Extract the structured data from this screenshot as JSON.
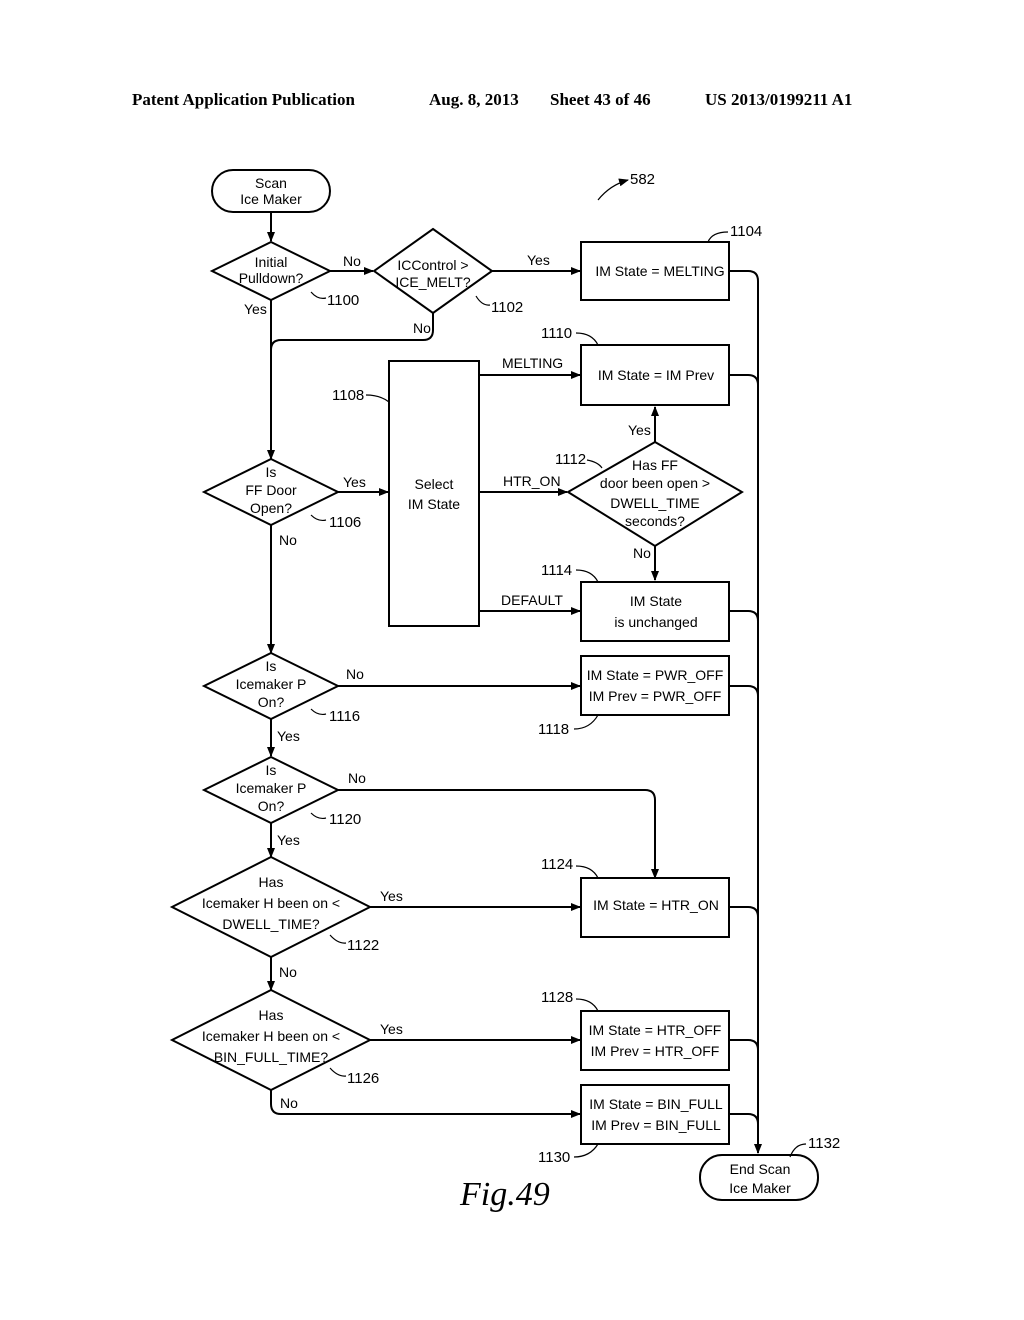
{
  "header": {
    "left": "Patent Application Publication",
    "date": "Aug. 8, 2013",
    "sheet": "Sheet 43 of 46",
    "pub_number": "US 2013/0199211 A1"
  },
  "figure": {
    "ref": "582",
    "caption": "Fig.49"
  },
  "nodes": {
    "start": {
      "lines": [
        "Scan",
        "Ice Maker"
      ]
    },
    "initial_pulldown": {
      "lines": [
        "Initial",
        "Pulldown?"
      ],
      "ref": "1100"
    },
    "iccontrol": {
      "lines": [
        "ICControl >",
        "ICE_MELT?"
      ],
      "ref": "1102"
    },
    "melting_state": {
      "lines": [
        "IM State = MELTING"
      ],
      "ref": "1104"
    },
    "ff_door": {
      "lines": [
        "Is",
        "FF Door",
        "Open?"
      ],
      "ref": "1106"
    },
    "select_state": {
      "lines": [
        "Select",
        "IM State"
      ],
      "ref": "1108"
    },
    "im_prev": {
      "lines": [
        "IM State = IM Prev"
      ],
      "ref": "1110"
    },
    "dwell_check": {
      "lines": [
        "Has FF",
        "door been open >",
        "DWELL_TIME",
        "seconds?"
      ],
      "ref": "1112"
    },
    "unchanged": {
      "lines": [
        "IM State",
        "is unchanged"
      ],
      "ref": "1114"
    },
    "icemaker_p1": {
      "lines": [
        "Is",
        "Icemaker P",
        "On?"
      ],
      "ref": "1116"
    },
    "pwr_off": {
      "lines": [
        "IM State = PWR_OFF",
        "IM Prev = PWR_OFF"
      ],
      "ref": "1118"
    },
    "icemaker_p2": {
      "lines": [
        "Is",
        "Icemaker P",
        "On?"
      ],
      "ref": "1120"
    },
    "heater_dwell": {
      "lines": [
        "Has",
        "Icemaker H been on <",
        "DWELL_TIME?"
      ],
      "ref": "1122"
    },
    "htr_on": {
      "lines": [
        "IM State = HTR_ON"
      ],
      "ref": "1124"
    },
    "heater_binfull": {
      "lines": [
        "Has",
        "Icemaker H been on <",
        "BIN_FULL_TIME?"
      ],
      "ref": "1126"
    },
    "htr_off": {
      "lines": [
        "IM State = HTR_OFF",
        "IM Prev = HTR_OFF"
      ],
      "ref": "1128"
    },
    "bin_full": {
      "lines": [
        "IM State = BIN_FULL",
        "IM Prev = BIN_FULL"
      ],
      "ref": "1130"
    },
    "end": {
      "lines": [
        "End Scan",
        "Ice Maker"
      ],
      "ref": "1132"
    }
  },
  "edge_labels": {
    "no": "No",
    "yes": "Yes",
    "melting": "MELTING",
    "htr_on": "HTR_ON",
    "default": "DEFAULT"
  }
}
